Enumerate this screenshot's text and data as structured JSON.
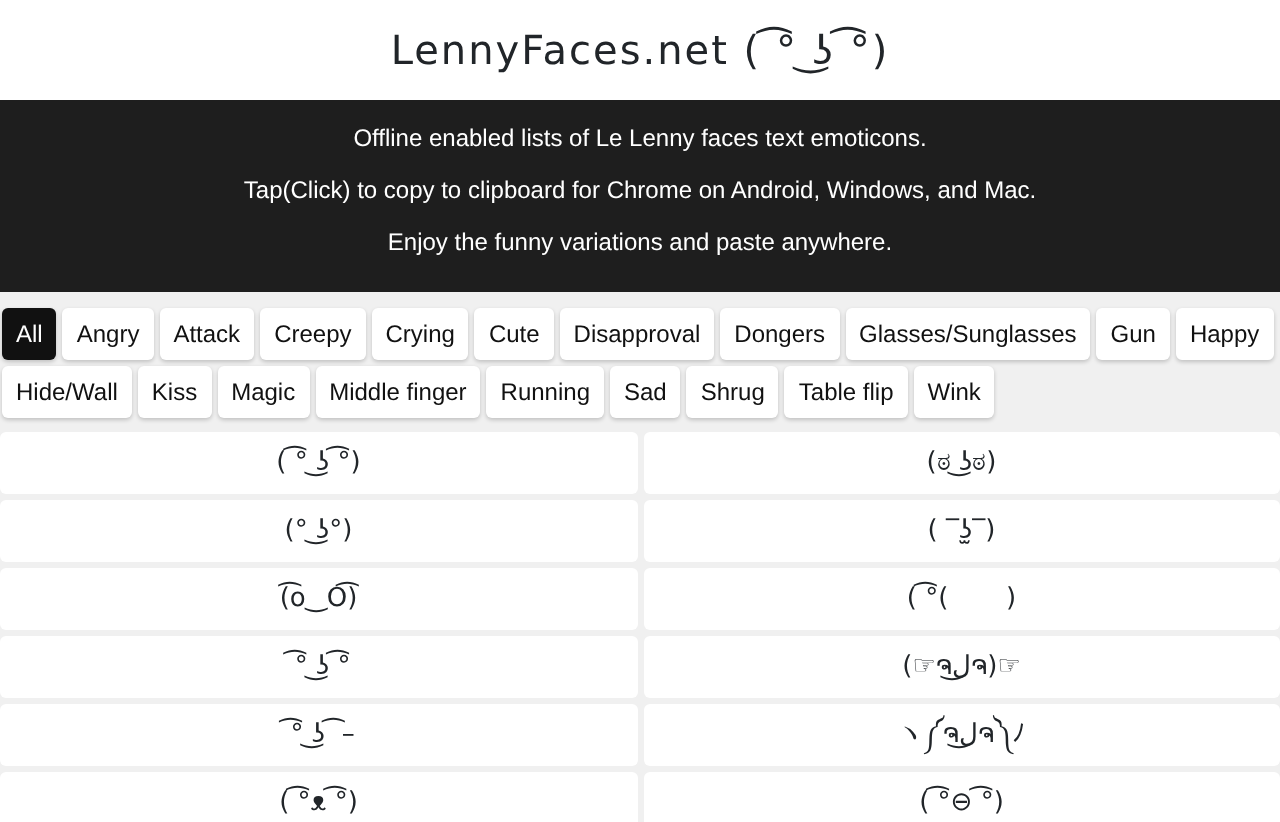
{
  "site_title": "LennyFaces.net ( ͡° ͜ʖ ͡°)",
  "intro": [
    "Offline enabled lists of Le Lenny faces text emoticons.",
    "Tap(Click) to copy to clipboard for Chrome on Android, Windows, and Mac.",
    "Enjoy the funny variations and paste anywhere."
  ],
  "tag_rows": [
    [
      {
        "label": "All",
        "selected": true
      },
      {
        "label": "Angry",
        "selected": false
      },
      {
        "label": "Attack",
        "selected": false
      },
      {
        "label": "Creepy",
        "selected": false
      },
      {
        "label": "Crying",
        "selected": false
      },
      {
        "label": "Cute",
        "selected": false
      },
      {
        "label": "Disapproval",
        "selected": false
      },
      {
        "label": "Dongers",
        "selected": false
      },
      {
        "label": "Glasses/Sunglasses",
        "selected": false
      },
      {
        "label": "Gun",
        "selected": false
      },
      {
        "label": "Happy",
        "selected": false
      }
    ],
    [
      {
        "label": "Hide/Wall",
        "selected": false
      },
      {
        "label": "Kiss",
        "selected": false
      },
      {
        "label": "Magic",
        "selected": false
      },
      {
        "label": "Middle finger",
        "selected": false
      },
      {
        "label": "Running",
        "selected": false
      },
      {
        "label": "Sad",
        "selected": false
      },
      {
        "label": "Shrug",
        "selected": false
      },
      {
        "label": "Table flip",
        "selected": false
      },
      {
        "label": "Wink",
        "selected": false
      }
    ]
  ],
  "faces": [
    [
      "( ͡° ͜ʖ ͡°)",
      "(ಠ ͜ʖಠ)"
    ],
    [
      "(° ͜ʖ°)",
      "( ‾ʖ̫‾)"
    ],
    [
      "(͡o‿O͡)",
      "( ͡°(       )"
    ],
    [
      " ͡° ͜ʖ ͡°",
      "(☞ຈل͜ຈ)☞"
    ],
    [
      " ͡° ͜ʖ ͡ –",
      "ヽ༼ຈل͜ຈ༽ﾉ"
    ],
    [
      "( ͡°ᴥ ͡°)",
      "( ͡°⊖ ͡°)"
    ]
  ]
}
